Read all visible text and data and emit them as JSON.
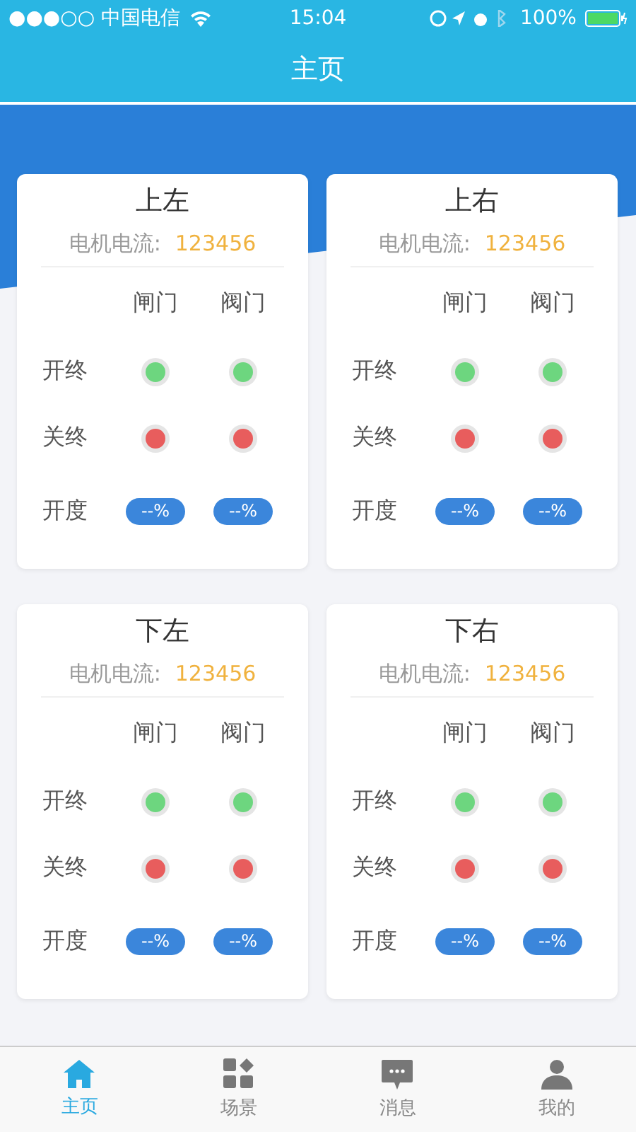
{
  "status_bar": {
    "carrier": "●●●○○ 中国电信",
    "time": "15:04",
    "battery": "100%"
  },
  "title": "主页",
  "cards": [
    {
      "title": "上左",
      "current_label": "电机电流:",
      "current_value": "123456",
      "columns": [
        "闸门",
        "阀门"
      ],
      "rows": [
        {
          "label": "开终",
          "kind": "lamp",
          "cells": [
            {
              "color": "#6dd67f"
            },
            {
              "color": "#6dd67f"
            }
          ]
        },
        {
          "label": "关终",
          "kind": "lamp",
          "cells": [
            {
              "color": "#e85d5d"
            },
            {
              "color": "#e85d5d"
            }
          ]
        },
        {
          "label": "开度",
          "kind": "badge",
          "cells": [
            {
              "text": "--%"
            },
            {
              "text": "--%"
            }
          ]
        }
      ]
    },
    {
      "title": "上右",
      "current_label": "电机电流:",
      "current_value": "123456",
      "columns": [
        "闸门",
        "阀门"
      ],
      "rows": [
        {
          "label": "开终",
          "kind": "lamp",
          "cells": [
            {
              "color": "#6dd67f"
            },
            {
              "color": "#6dd67f"
            }
          ]
        },
        {
          "label": "关终",
          "kind": "lamp",
          "cells": [
            {
              "color": "#e85d5d"
            },
            {
              "color": "#e85d5d"
            }
          ]
        },
        {
          "label": "开度",
          "kind": "badge",
          "cells": [
            {
              "text": "--%"
            },
            {
              "text": "--%"
            }
          ]
        }
      ]
    },
    {
      "title": "下左",
      "current_label": "电机电流:",
      "current_value": "123456",
      "columns": [
        "闸门",
        "阀门"
      ],
      "rows": [
        {
          "label": "开终",
          "kind": "lamp",
          "cells": [
            {
              "color": "#6dd67f"
            },
            {
              "color": "#6dd67f"
            }
          ]
        },
        {
          "label": "关终",
          "kind": "lamp",
          "cells": [
            {
              "color": "#e85d5d"
            },
            {
              "color": "#e85d5d"
            }
          ]
        },
        {
          "label": "开度",
          "kind": "badge",
          "cells": [
            {
              "text": "--%"
            },
            {
              "text": "--%"
            }
          ]
        }
      ]
    },
    {
      "title": "下右",
      "current_label": "电机电流:",
      "current_value": "123456",
      "columns": [
        "闸门",
        "阀门"
      ],
      "rows": [
        {
          "label": "开终",
          "kind": "lamp",
          "cells": [
            {
              "color": "#6dd67f"
            },
            {
              "color": "#6dd67f"
            }
          ]
        },
        {
          "label": "关终",
          "kind": "lamp",
          "cells": [
            {
              "color": "#e85d5d"
            },
            {
              "color": "#e85d5d"
            }
          ]
        },
        {
          "label": "开度",
          "kind": "badge",
          "cells": [
            {
              "text": "--%"
            },
            {
              "text": "--%"
            }
          ]
        }
      ]
    }
  ],
  "tabs": [
    {
      "label": "主页",
      "selected": true
    },
    {
      "label": "场景",
      "selected": false
    },
    {
      "label": "消息",
      "selected": false
    },
    {
      "label": "我的",
      "selected": false
    }
  ]
}
